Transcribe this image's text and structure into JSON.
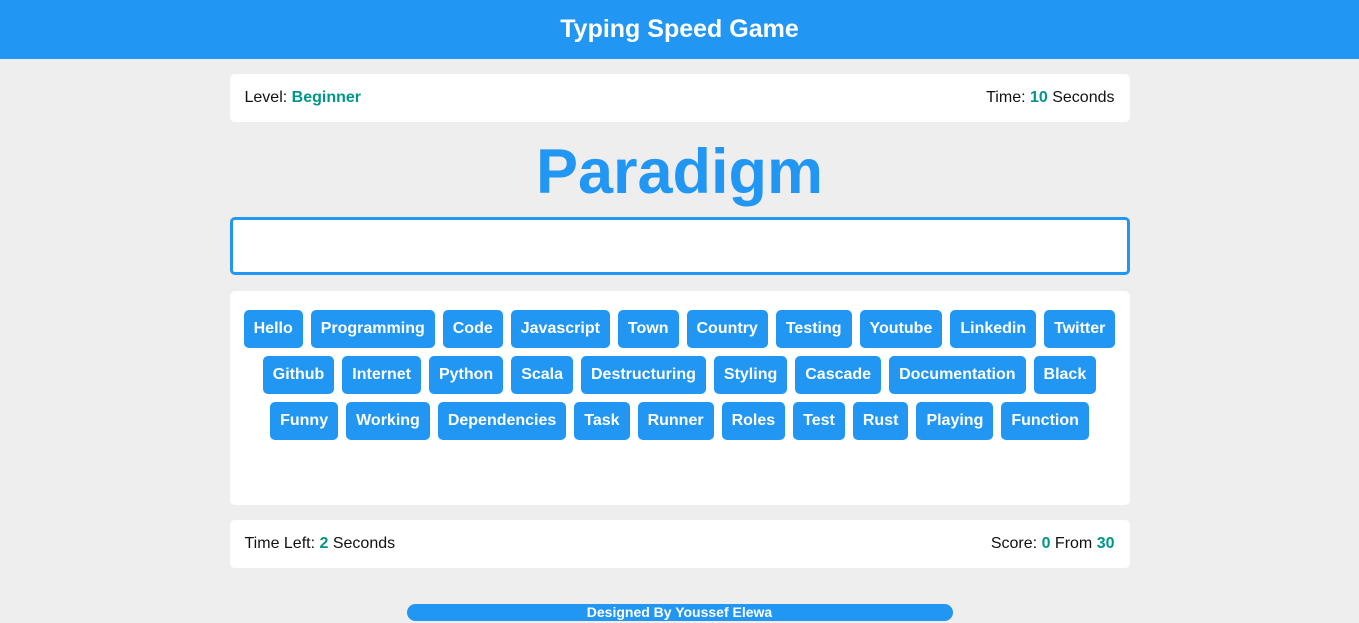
{
  "header": {
    "title": "Typing Speed Game"
  },
  "level_bar": {
    "level_label": "Level:",
    "level_value": "Beginner",
    "time_label": "Time:",
    "time_value": "10",
    "time_unit": "Seconds"
  },
  "current_word": "Paradigm",
  "input": {
    "value": "",
    "placeholder": ""
  },
  "words": [
    "Hello",
    "Programming",
    "Code",
    "Javascript",
    "Town",
    "Country",
    "Testing",
    "Youtube",
    "Linkedin",
    "Twitter",
    "Github",
    "Internet",
    "Python",
    "Scala",
    "Destructuring",
    "Styling",
    "Cascade",
    "Documentation",
    "Black",
    "Funny",
    "Working",
    "Dependencies",
    "Task",
    "Runner",
    "Roles",
    "Test",
    "Rust",
    "Playing",
    "Function"
  ],
  "status_bar": {
    "time_left_label": "Time Left:",
    "time_left_value": "2",
    "time_left_unit": "Seconds",
    "score_label": "Score:",
    "score_value": "0",
    "score_from_label": "From",
    "score_total": "30"
  },
  "footer": {
    "text": "Designed By Youssef Elewa"
  },
  "colors": {
    "primary": "#2196f3",
    "accent": "#009688",
    "background": "#eeeeee"
  }
}
